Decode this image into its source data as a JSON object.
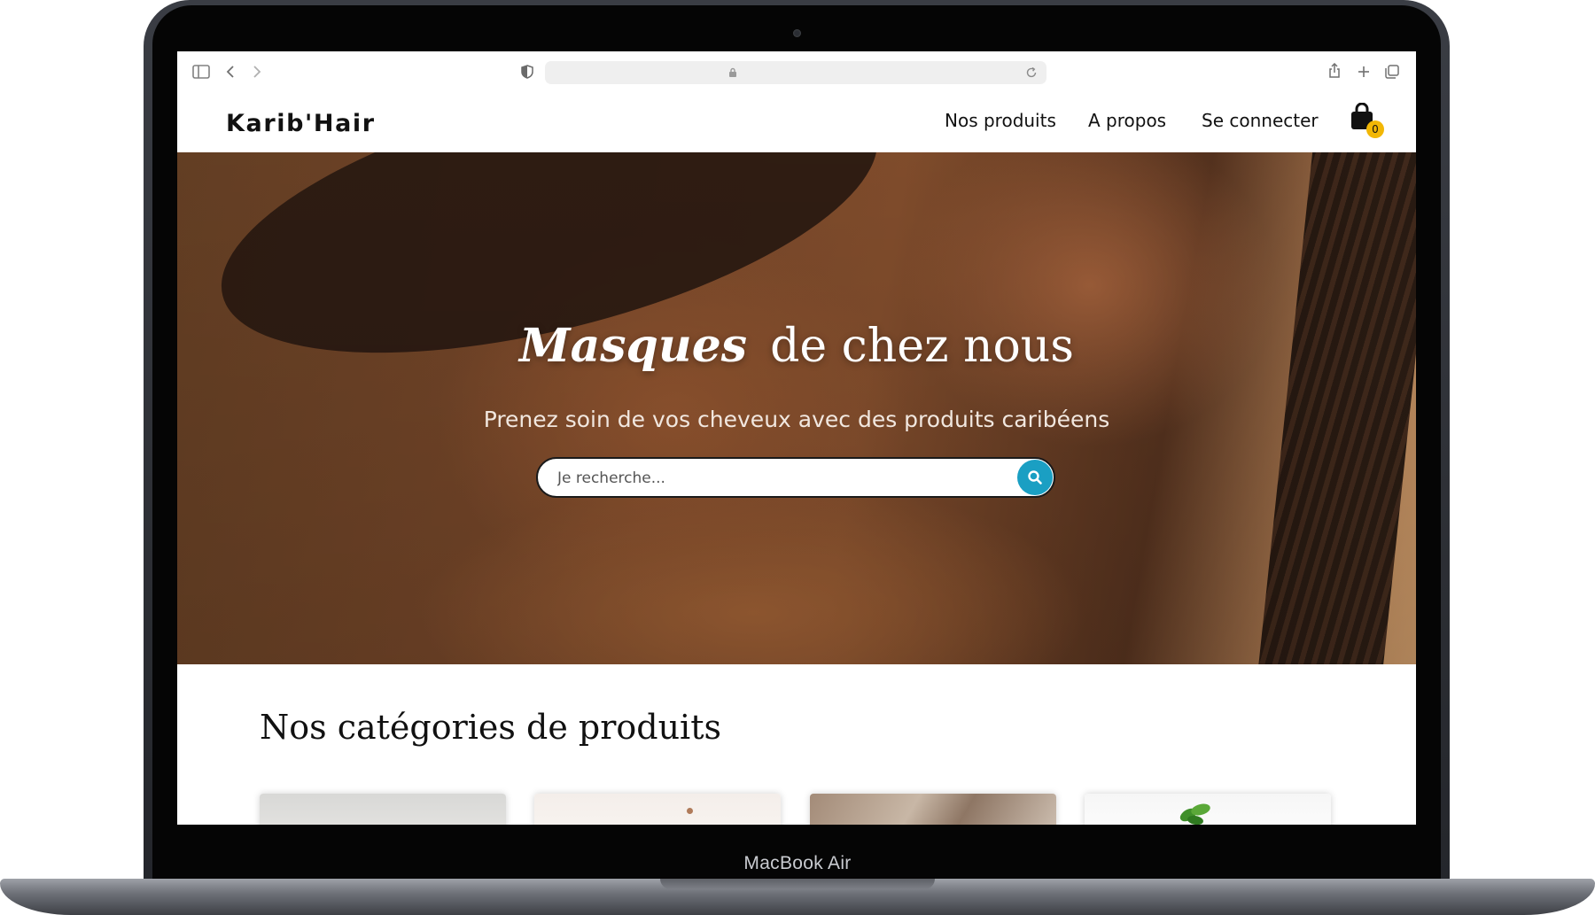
{
  "device": {
    "model_label": "MacBook Air"
  },
  "browser": {
    "url_text": "",
    "icons": [
      "sidebar-icon",
      "back-icon",
      "forward-icon",
      "shield-icon",
      "lock-icon",
      "reload-icon",
      "share-icon",
      "new-tab-icon",
      "tabs-icon"
    ]
  },
  "site": {
    "logo": "Karib'Hair",
    "nav": [
      {
        "label": "Nos produits"
      },
      {
        "label": "A propos"
      },
      {
        "label": "Se connecter"
      }
    ],
    "cart_count": "0"
  },
  "hero": {
    "title_emphasis": "Masques",
    "title_rest": "de chez nous",
    "subtitle": "Prenez soin de vos cheveux avec des produits caribéens",
    "search_placeholder": "Je recherche..."
  },
  "categories": {
    "title": "Nos catégories de produits",
    "cards": [
      {
        "name": "category-card-1"
      },
      {
        "name": "category-card-2"
      },
      {
        "name": "category-card-3"
      },
      {
        "name": "category-card-4"
      }
    ]
  },
  "colors": {
    "accent": "#1a9fc3",
    "badge": "#f2b705",
    "text": "#111111"
  }
}
